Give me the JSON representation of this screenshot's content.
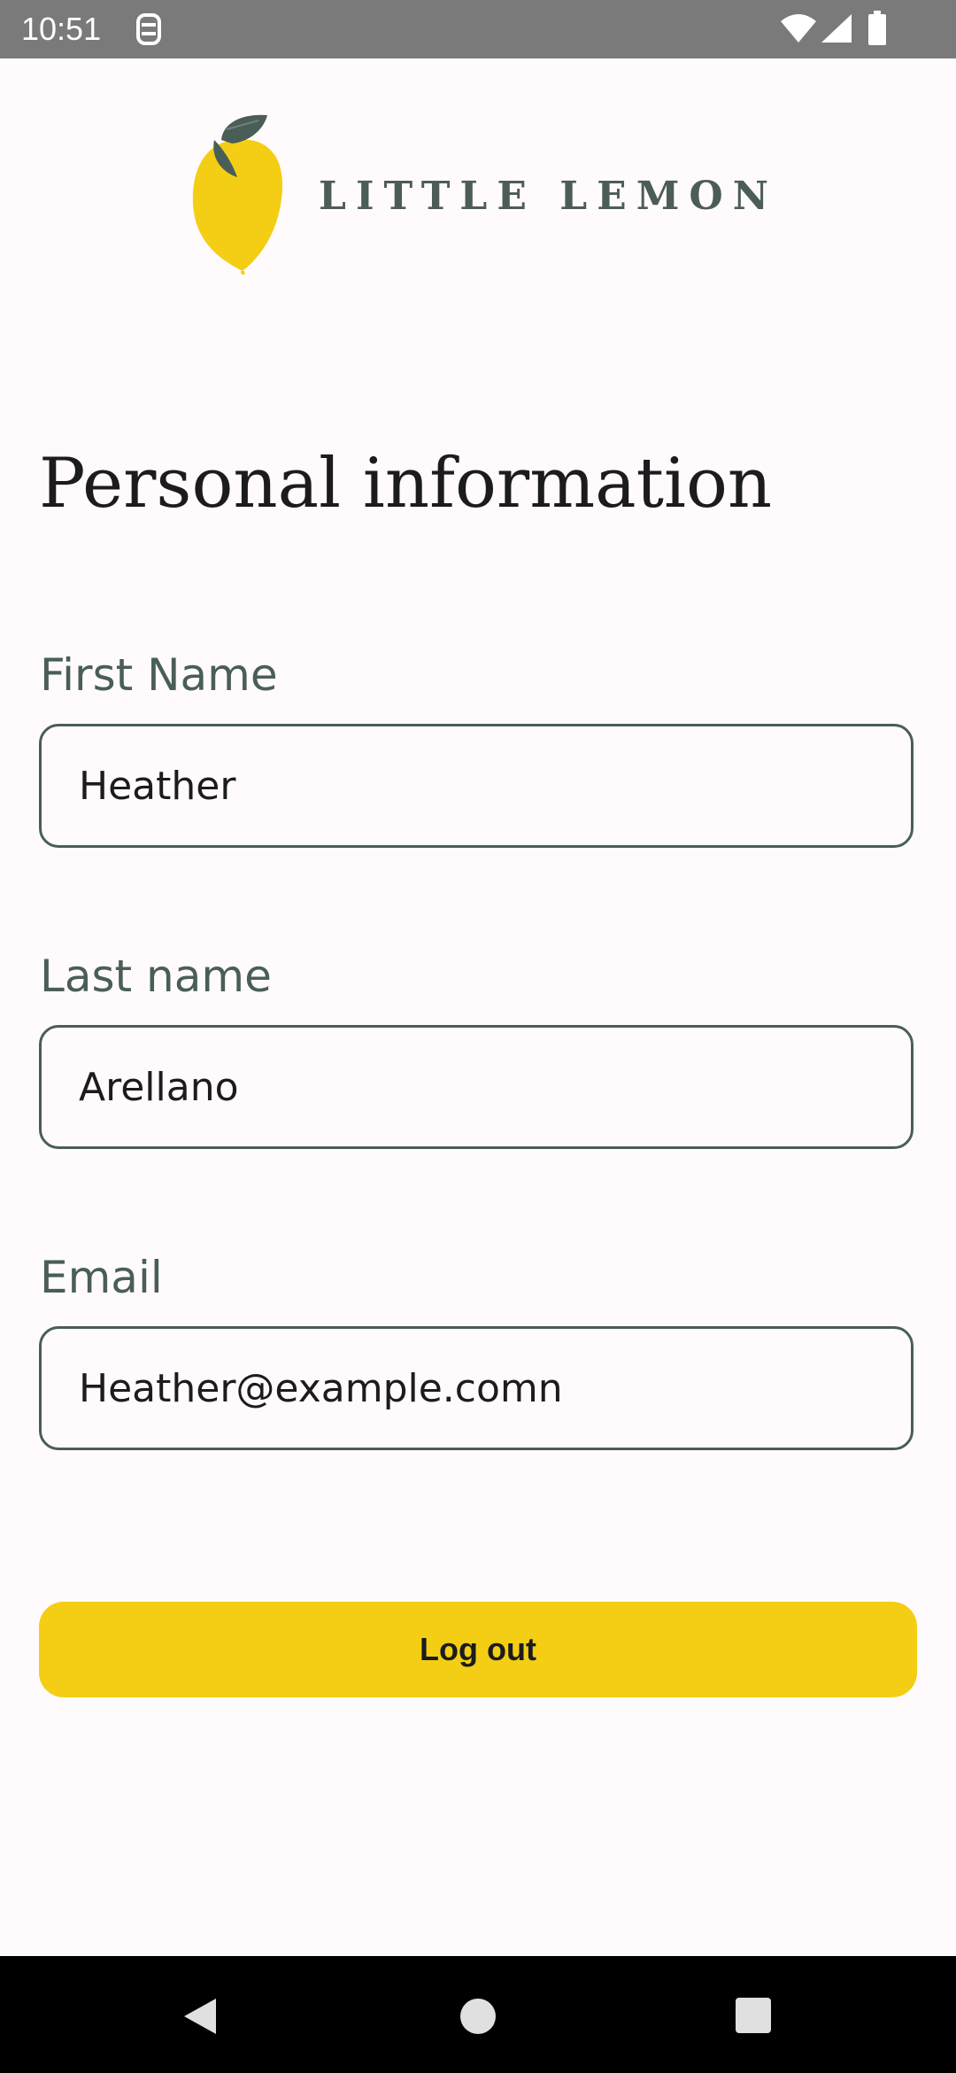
{
  "status_bar": {
    "time": "10:51",
    "icons": [
      "notification-icon",
      "wifi-icon",
      "signal-icon",
      "battery-icon"
    ]
  },
  "logo": {
    "text": "LITTLE LEMON",
    "colors": {
      "lemon": "#f4ce14",
      "leaf": "#495e57"
    }
  },
  "page": {
    "title": "Personal information"
  },
  "form": {
    "first_name": {
      "label": "First Name",
      "value": "Heather"
    },
    "last_name": {
      "label": "Last name",
      "value": "Arellano"
    },
    "email": {
      "label": "Email",
      "value": "Heather@example.comn"
    }
  },
  "actions": {
    "logout_label": "Log out"
  },
  "nav_bar": {
    "buttons": [
      "back-icon",
      "home-icon",
      "recents-icon"
    ]
  },
  "colors": {
    "primary_yellow": "#f4ce14",
    "primary_green": "#495e57",
    "background": "#fffbfd"
  }
}
